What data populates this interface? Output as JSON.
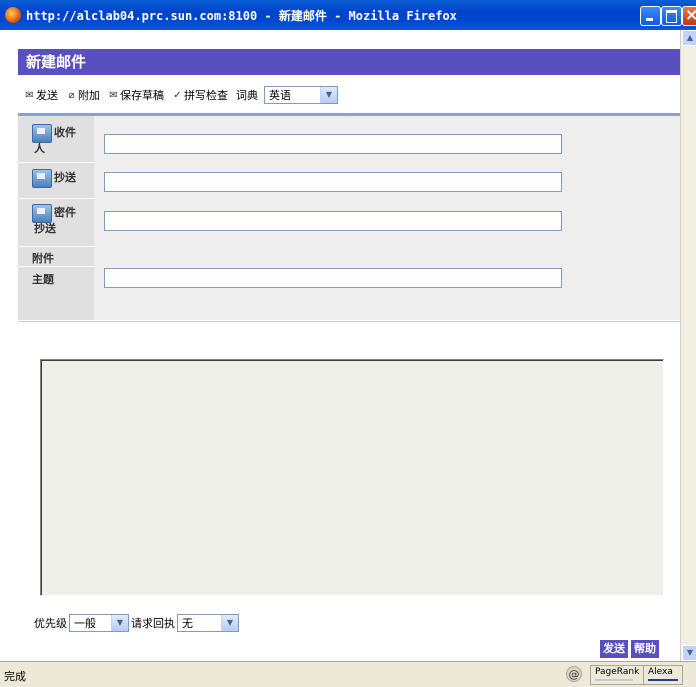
{
  "window": {
    "title": "http://alclab04.prc.sun.com:8100 - 新建邮件 - Mozilla Firefox"
  },
  "page": {
    "header": "新建邮件"
  },
  "toolbar": {
    "send": "发送",
    "attach": "附加",
    "save_draft": "保存草稿",
    "spellcheck": "拼写检查",
    "dict_label": "词典",
    "dict_value": "英语"
  },
  "fields": {
    "to_label_1": "收件",
    "to_label_2": "人",
    "to_value": "",
    "cc_label": "抄送",
    "cc_value": "",
    "bcc_label_1": "密件",
    "bcc_label_2": "抄送",
    "bcc_value": "",
    "attachments_label": "附件",
    "subject_label": "主题",
    "subject_value": ""
  },
  "options": {
    "priority_label": "优先级",
    "priority_value": "一般",
    "receipt_label": "请求回执",
    "receipt_value": "无"
  },
  "actions": {
    "send": "发送",
    "help": "帮助"
  },
  "status": {
    "text": "完成",
    "pagerank": "PageRank",
    "alexa": "Alexa"
  }
}
